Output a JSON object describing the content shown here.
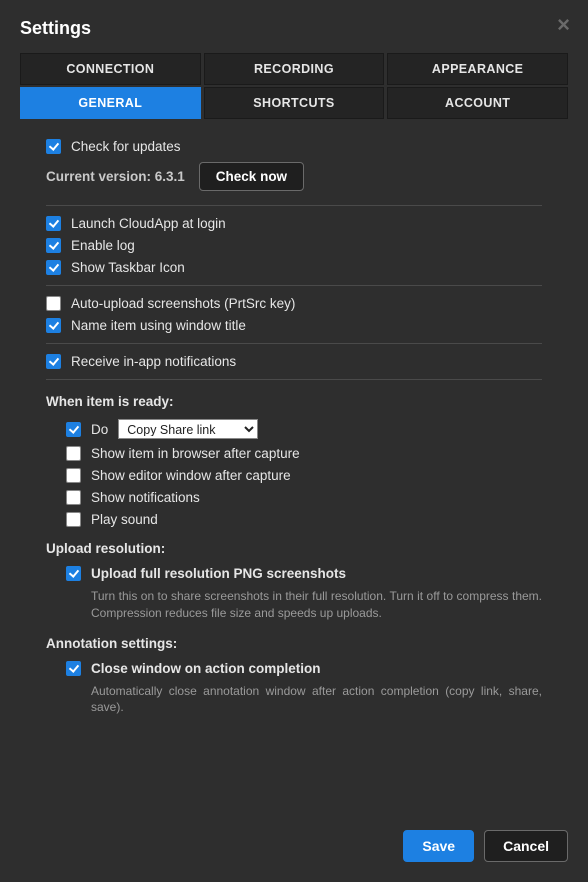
{
  "title": "Settings",
  "tabs": {
    "row1": [
      "CONNECTION",
      "RECORDING",
      "APPEARANCE"
    ],
    "row2": [
      "GENERAL",
      "SHORTCUTS",
      "ACCOUNT"
    ],
    "active": "GENERAL"
  },
  "general": {
    "check_updates": {
      "label": "Check for updates",
      "checked": true
    },
    "version_label": "Current version: 6.3.1",
    "check_now": "Check now",
    "launch_login": {
      "label": "Launch CloudApp at login",
      "checked": true
    },
    "enable_log": {
      "label": "Enable log",
      "checked": true
    },
    "show_taskbar": {
      "label": "Show Taskbar Icon",
      "checked": true
    },
    "auto_upload": {
      "label": "Auto-upload screenshots (PrtSrc key)",
      "checked": false
    },
    "name_item": {
      "label": "Name item using window title",
      "checked": true
    },
    "notifications": {
      "label": "Receive in-app notifications",
      "checked": true
    },
    "when_ready_label": "When item is ready:",
    "do": {
      "label": "Do",
      "checked": true,
      "selected": "Copy Share link"
    },
    "show_browser": {
      "label": "Show item in browser after capture",
      "checked": false
    },
    "show_editor": {
      "label": "Show editor window after capture",
      "checked": false
    },
    "show_notif": {
      "label": "Show notifications",
      "checked": false
    },
    "play_sound": {
      "label": "Play sound",
      "checked": false
    },
    "upload_res_label": "Upload resolution:",
    "upload_full": {
      "label": "Upload full resolution PNG screenshots",
      "checked": true,
      "desc": "Turn this on to share screenshots in their full resolution. Turn it off to compress them. Compression reduces file size and speeds up uploads."
    },
    "annotation_label": "Annotation settings:",
    "close_window": {
      "label": "Close window on action completion",
      "checked": true,
      "desc": "Automatically close annotation window after action completion (copy link, share, save)."
    }
  },
  "footer": {
    "save": "Save",
    "cancel": "Cancel"
  }
}
